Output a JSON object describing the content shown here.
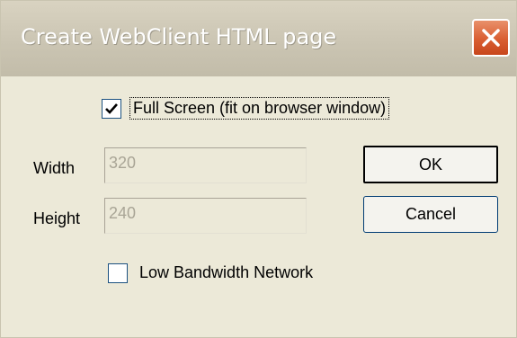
{
  "window": {
    "title": "Create WebClient HTML page",
    "close_icon": "close-icon"
  },
  "full_screen": {
    "label": "Full Screen (fit on browser window)",
    "checked": true
  },
  "width": {
    "label": "Width",
    "value": "320"
  },
  "height": {
    "label": "Height",
    "value": "240"
  },
  "buttons": {
    "ok_label": "OK",
    "cancel_label": "Cancel"
  },
  "low_bandwidth": {
    "label": "Low Bandwidth Network",
    "checked": false
  },
  "colors": {
    "close_button": "#d95e32",
    "window_bg": "#ece9d8",
    "titlebar_inactive": "#c9c3b1"
  }
}
